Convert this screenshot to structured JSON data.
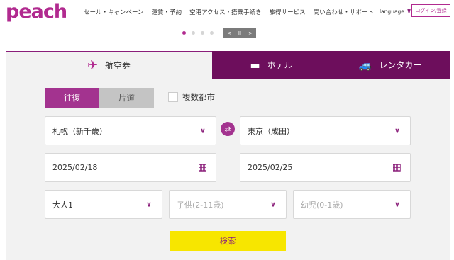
{
  "brand": {
    "logo": "peach",
    "accent": "#b12a8f",
    "tab_bg": "#6d0e5c",
    "search_bg": "#f7e600"
  },
  "nav": {
    "items": [
      "セール・キャンペーン",
      "運賃・予約",
      "空港アクセス・搭乗手続き",
      "旅得サービス",
      "問い合わせ・サポート"
    ],
    "language_label": "language",
    "login_label": "ログイン/登録"
  },
  "carousel": {
    "dots": 4,
    "active": 0,
    "prev": "<",
    "pause": "II",
    "next": ">"
  },
  "tabs": {
    "flight": "航空券",
    "hotel": "ホテル",
    "car": "レンタカー"
  },
  "trip_type": {
    "round_trip": "往復",
    "one_way": "片道",
    "multi_city": "複数都市"
  },
  "form": {
    "origin": "札幌（新千歳）",
    "destination": "東京（成田）",
    "depart_date": "2025/02/18",
    "return_date": "2025/02/25",
    "adults": "大人1",
    "children": "子供(2-11歳)",
    "infants": "幼児(0-1歳)"
  },
  "search_label": "検索"
}
